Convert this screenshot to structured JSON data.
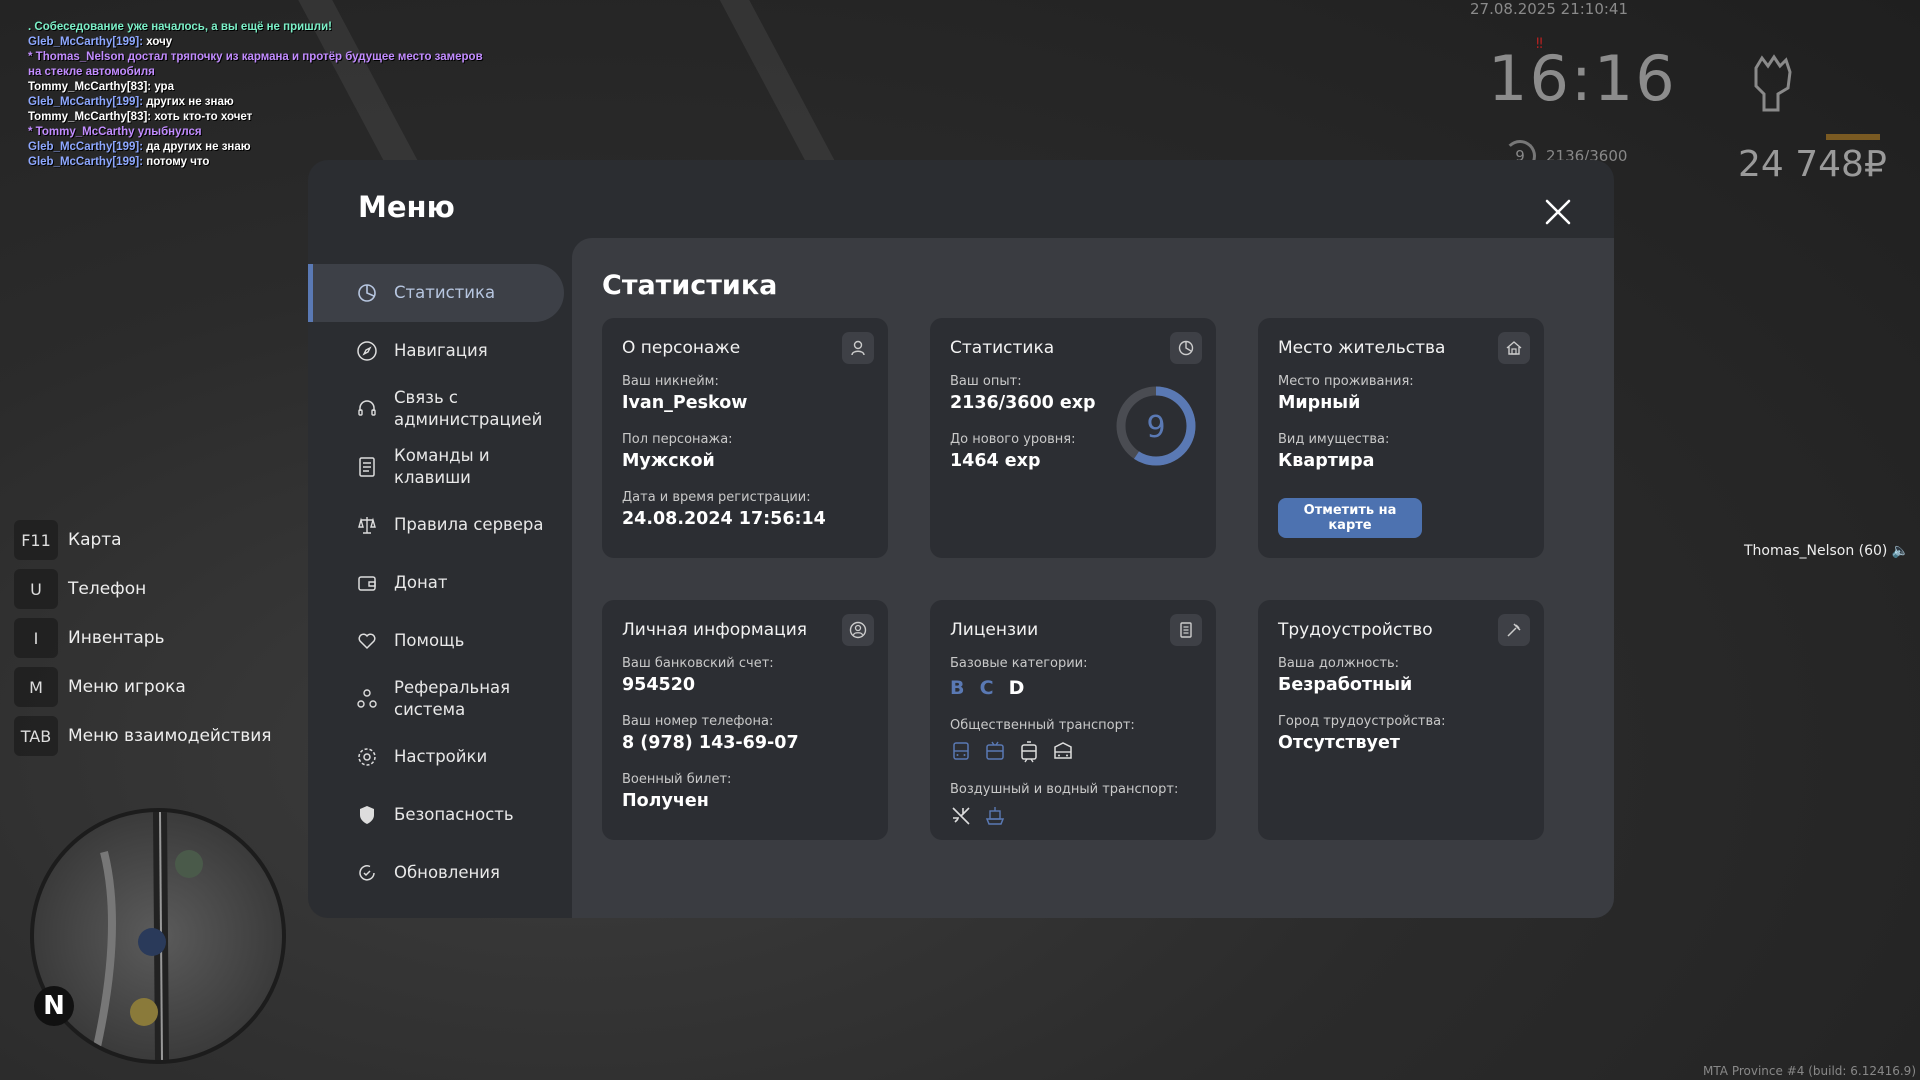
{
  "hud": {
    "chat": [
      {
        "text": ". Собеседование уже началось, а вы ещё не пришли!",
        "color": "#7cf0c8"
      },
      {
        "name": "Gleb_McCarthy[199]:",
        "text": " хочу",
        "color": "#8ea8ff"
      },
      {
        "text": "* Thomas_Nelson достал тряпочку из кармана и протёр будущее место замеров",
        "color": "#c28cff"
      },
      {
        "text": "на стекле автомобиля",
        "color": "#c28cff"
      },
      {
        "text": "Tommy_McCarthy[83]: ура",
        "color": "#ffffff"
      },
      {
        "name": "Gleb_McCarthy[199]:",
        "text": " других не знаю",
        "color": "#8ea8ff"
      },
      {
        "text": "Tommy_McCarthy[83]: хоть кто-то хочет",
        "color": "#ffffff"
      },
      {
        "text": "* Tommy_McCarthy улыбнулся",
        "color": "#c28cff"
      },
      {
        "name": "Gleb_McCarthy[199]:",
        "text": " да других не знаю",
        "color": "#8ea8ff"
      },
      {
        "name": "Gleb_McCarthy[199]:",
        "text": " потому что",
        "color": "#8ea8ff"
      }
    ],
    "timestamp": "27.08.2025 21:10:41",
    "clock": "16:16",
    "xp_level": "9",
    "xp_progress": "2136/3600",
    "money": "24 748₽",
    "player_tag": "Thomas_Nelson (60)",
    "build": "MTA Province #4 (build: 6.12416.9)",
    "minimap_north": "N",
    "hotkeys": [
      {
        "key": "F11",
        "label": "Карта"
      },
      {
        "key": "U",
        "label": "Телефон"
      },
      {
        "key": "I",
        "label": "Инвентарь"
      },
      {
        "key": "M",
        "label": "Меню игрока"
      },
      {
        "key": "TAB",
        "label": "Меню взаимодействия"
      }
    ]
  },
  "menu": {
    "title": "Меню",
    "close_icon": "close-icon",
    "nav": [
      {
        "label": "Статистика",
        "icon": "pie-chart-icon",
        "active": true
      },
      {
        "label": "Навигация",
        "icon": "compass-icon"
      },
      {
        "label": "Связь с администрацией",
        "icon": "headset-icon"
      },
      {
        "label": "Команды и клавиши",
        "icon": "document-icon"
      },
      {
        "label": "Правила сервера",
        "icon": "scales-icon"
      },
      {
        "label": "Донат",
        "icon": "wallet-icon"
      },
      {
        "label": "Помощь",
        "icon": "heart-hand-icon"
      },
      {
        "label": "Реферальная система",
        "icon": "people-icon"
      },
      {
        "label": "Настройки",
        "icon": "gear-icon"
      },
      {
        "label": "Безопасность",
        "icon": "shield-icon"
      },
      {
        "label": "Обновления",
        "icon": "refresh-icon"
      }
    ],
    "content_title": "Статистика",
    "cards": {
      "character": {
        "title": "О персонаже",
        "nick_label": "Ваш никнейм:",
        "nick": "Ivan_Peskow",
        "gender_label": "Пол персонажа:",
        "gender": "Мужской",
        "reg_label": "Дата и время регистрации:",
        "reg": "24.08.2024 17:56:14"
      },
      "stats": {
        "title": "Статистика",
        "exp_label": "Ваш опыт:",
        "exp": "2136/3600 exp",
        "next_label": "До нового уровня:",
        "next": "1464 exp",
        "level": "9",
        "progress": 0.593
      },
      "residence": {
        "title": "Место жительства",
        "place_label": "Место проживания:",
        "place": "Мирный",
        "type_label": "Вид имущества:",
        "type": "Квартира",
        "button": "Отметить на карте"
      },
      "personal": {
        "title": "Личная информация",
        "bank_label": "Ваш банковский счет:",
        "bank": "954520",
        "phone_label": "Ваш номер телефона:",
        "phone": "8 (978) 143-69-07",
        "military_label": "Военный билет:",
        "military": "Получен"
      },
      "licenses": {
        "title": "Лицензии",
        "base_label": "Базовые категории:",
        "categories": [
          {
            "cat": "B",
            "color": "#5a79b4"
          },
          {
            "cat": "C",
            "color": "#5a79b4"
          },
          {
            "cat": "D",
            "color": "#ffffff"
          }
        ],
        "public_label": "Общественный транспорт:",
        "public_icons": [
          "bus-icon",
          "trolleybus-icon",
          "tram-icon",
          "minibus-icon"
        ],
        "air_label": "Воздушный и водный транспорт:",
        "air_icons": [
          "plane-icon",
          "boat-icon"
        ],
        "accent": "#5a79b4"
      },
      "employment": {
        "title": "Трудоустройство",
        "pos_label": "Ваша должность:",
        "pos": "Безработный",
        "city_label": "Город трудоустройства:",
        "city": "Отсутствует"
      }
    }
  }
}
